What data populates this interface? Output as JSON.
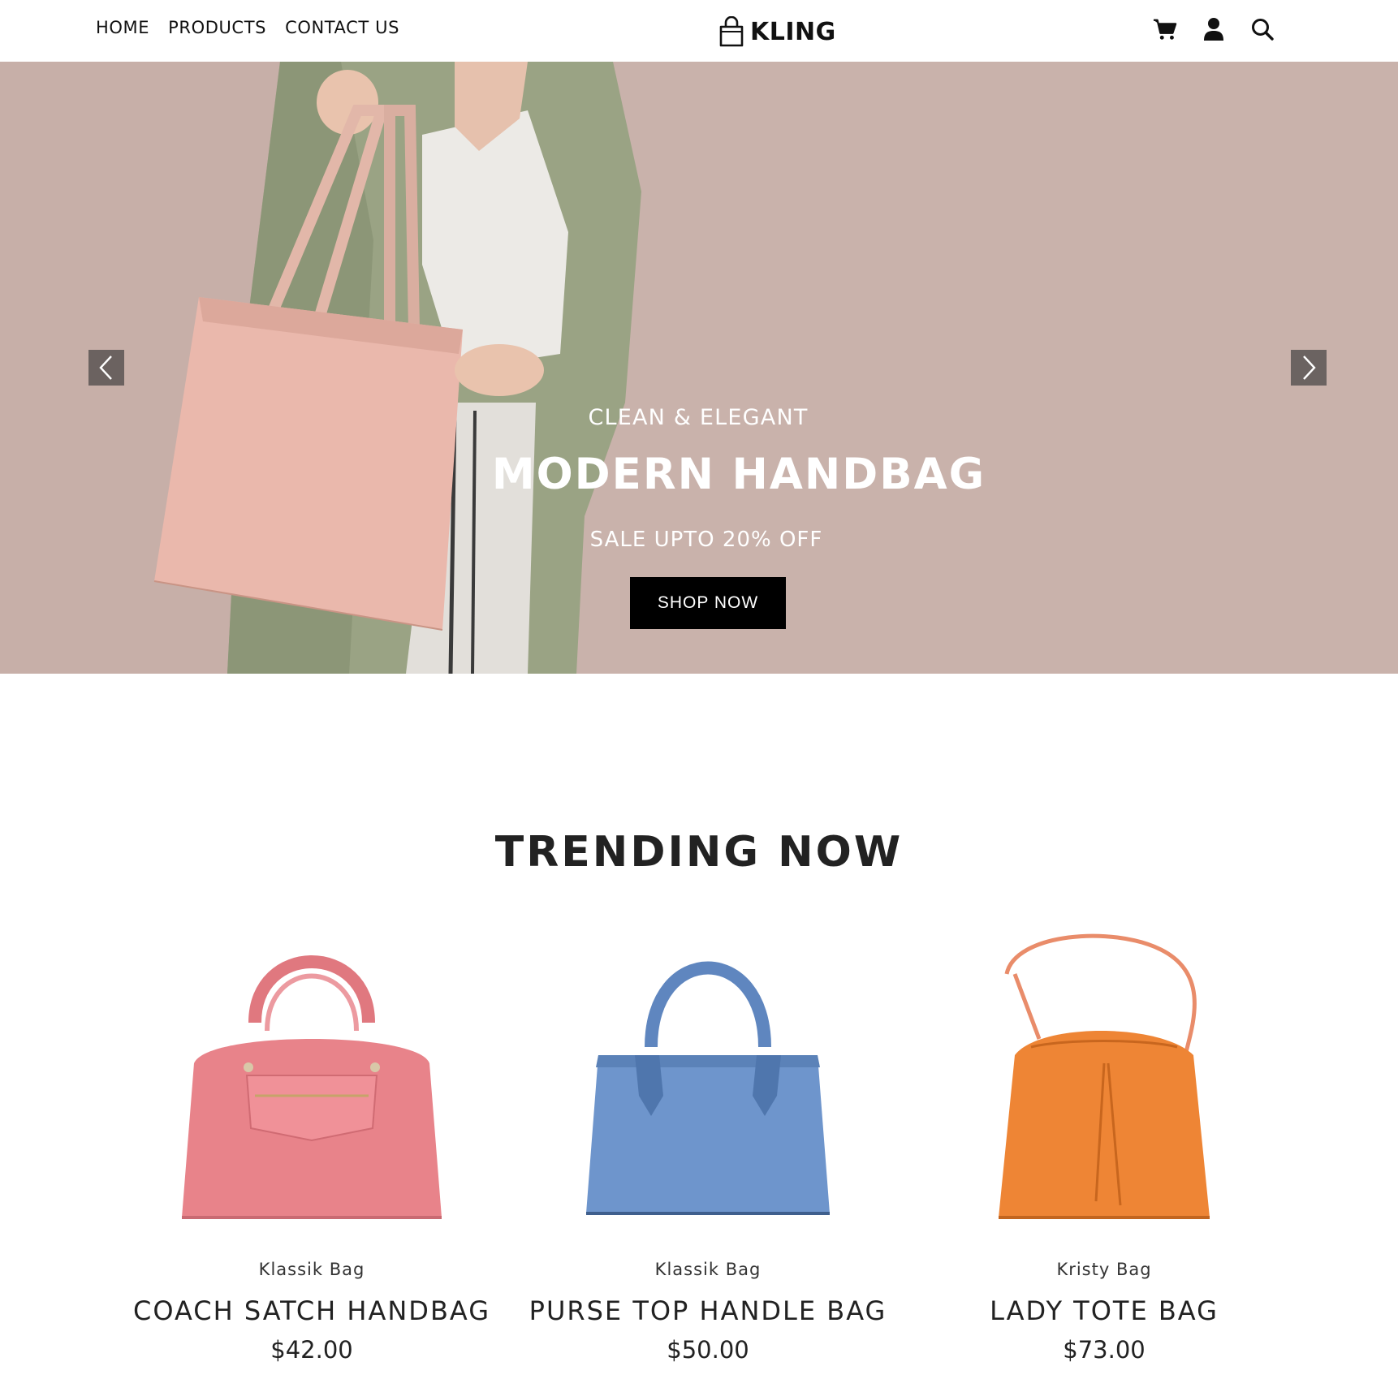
{
  "header": {
    "nav": [
      "HOME",
      "PRODUCTS",
      "CONTACT US"
    ],
    "logo_text": "KLING",
    "icons": [
      "cart-icon",
      "user-icon",
      "search-icon"
    ]
  },
  "hero": {
    "eyebrow": "CLEAN & ELEGANT",
    "title": "MODERN HANDBAG",
    "sale": "SALE UPTO 20% OFF",
    "button": "SHOP NOW",
    "colors": {
      "background": "#c9b2ab",
      "button": "#000000"
    }
  },
  "trending": {
    "title": "TRENDING NOW",
    "products": [
      {
        "brand": "Klassik Bag",
        "name": "COACH SATCH HANDBAG",
        "price": "$42.00",
        "color": "#e8838a"
      },
      {
        "brand": "Klassik Bag",
        "name": "PURSE TOP HANDLE BAG",
        "price": "$50.00",
        "color": "#6e95cc"
      },
      {
        "brand": "Kristy Bag",
        "name": "LADY TOTE BAG",
        "price": "$73.00",
        "color": "#ee8535"
      }
    ]
  }
}
